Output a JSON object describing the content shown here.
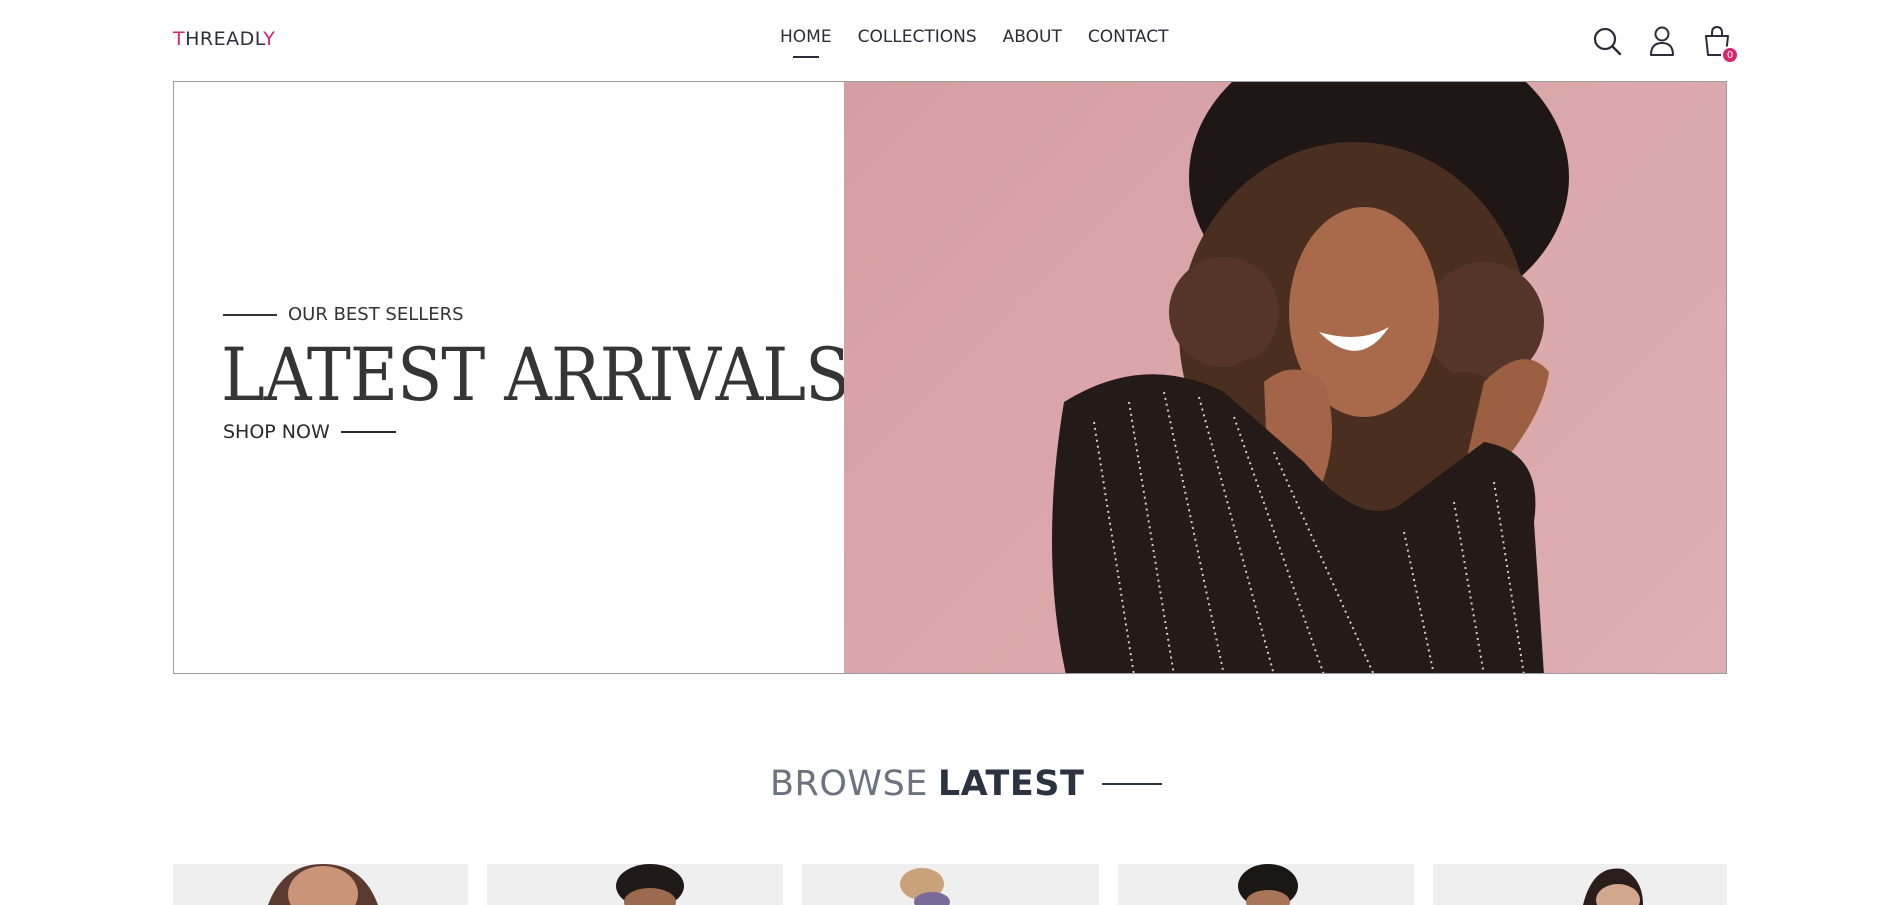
{
  "brand": {
    "first_letter": "T",
    "middle": "HREADL",
    "last_letter": "Y",
    "accent_color": "#d6246e"
  },
  "nav": {
    "items": [
      {
        "label": "HOME",
        "active": true
      },
      {
        "label": "COLLECTIONS",
        "active": false
      },
      {
        "label": "ABOUT",
        "active": false
      },
      {
        "label": "CONTACT",
        "active": false
      }
    ]
  },
  "header_icons": {
    "search": "search-icon",
    "account": "user-icon",
    "cart": "shopping-bag-icon",
    "cart_count": "0"
  },
  "hero": {
    "eyebrow": "OUR BEST SELLERS",
    "title": "LATEST ARRIVALS",
    "cta": "SHOP NOW",
    "image_background": "#d9a4a7"
  },
  "browse": {
    "light": "BROWSE",
    "bold": "LATEST"
  },
  "products": [
    {
      "name": "product-1"
    },
    {
      "name": "product-2"
    },
    {
      "name": "product-3"
    },
    {
      "name": "product-4"
    },
    {
      "name": "product-5"
    }
  ]
}
